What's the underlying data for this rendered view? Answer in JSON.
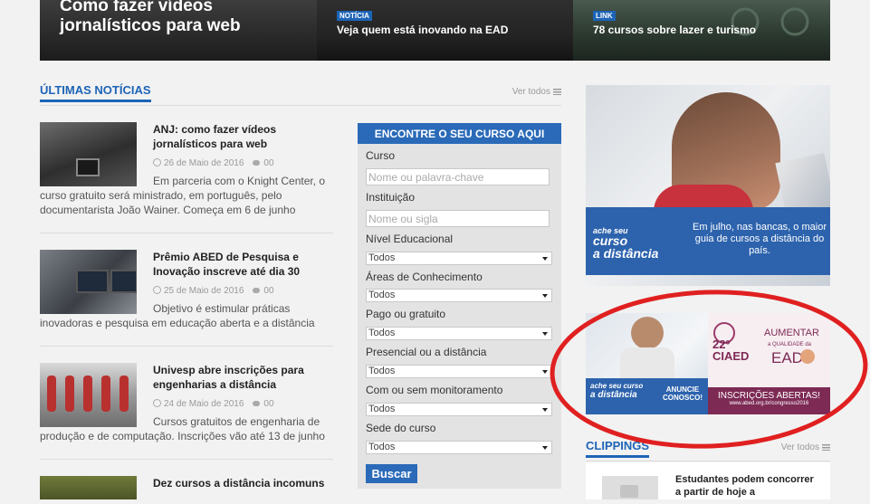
{
  "top_features": [
    {
      "title": "Como fazer vídeos jornalísticos para web"
    },
    {
      "tag": "NOTÍCIA",
      "title": "Veja quem está inovando na EAD"
    },
    {
      "tag": "LINK",
      "title": "78 cursos sobre lazer e turismo"
    }
  ],
  "latest_news": {
    "heading": "ÚLTIMAS NOTÍCIAS",
    "see_all": "Ver todos",
    "items": [
      {
        "title": "ANJ: como fazer vídeos jornalísticos para web",
        "date": "26 de Maio de 2016",
        "comments": "00",
        "excerpt": "Em parceria com o Knight Center, o curso gratuito será ministrado, em português, pelo documentarista João Wainer. Começa em 6 de junho"
      },
      {
        "title": "Prêmio ABED de Pesquisa e Inovação inscreve até dia 30",
        "date": "25 de Maio de 2016",
        "comments": "00",
        "excerpt": "Objetivo é estimular práticas inovadoras e pesquisa em educação aberta e a distância"
      },
      {
        "title": "Univesp abre inscrições para engenharias a distância",
        "date": "24 de Maio de 2016",
        "comments": "00",
        "excerpt": "Cursos gratuitos de engenharia de produção e de computação. Inscrições vão até 13 de junho"
      },
      {
        "title": "Dez cursos a distância incomuns"
      }
    ]
  },
  "course_search": {
    "heading": "ENCONTRE O SEU CURSO AQUI",
    "fields": {
      "curso_label": "Curso",
      "curso_placeholder": "Nome ou palavra-chave",
      "instituicao_label": "Instituição",
      "instituicao_placeholder": "Nome ou sigla",
      "nivel_label": "Nível Educacional",
      "nivel_value": "Todos",
      "areas_label": "Áreas de Conhecimento",
      "areas_value": "Todos",
      "pago_label": "Pago ou gratuito",
      "pago_value": "Todos",
      "presencial_label": "Presencial ou a distância",
      "presencial_value": "Todos",
      "monitoramento_label": "Com ou sem monitoramento",
      "monitoramento_value": "Todos",
      "sede_label": "Sede do curso",
      "sede_value": "Todos"
    },
    "button": "Buscar"
  },
  "ads": {
    "ad1": {
      "logo_line1": "ache seu",
      "logo_line2": "curso",
      "logo_line3": "a distância",
      "text": "Em julho, nas bancas, o maior guia de cursos a distância do país."
    },
    "ad2": {
      "logo_line1": "ache seu curso",
      "logo_line2": "a distância",
      "cta": "ANUNCIE CONOSCO!",
      "event_number": "22º",
      "event_name": "CIAED",
      "slogan_1": "AUMENTAR",
      "slogan_2": "a QUALIDADE da",
      "slogan_3": "EAD",
      "footer": "INSCRIÇÕES ABERTAS!",
      "url": "www.abed.org.br/congresso2016"
    }
  },
  "clippings": {
    "heading": "CLIPPINGS",
    "see_all": "Ver todos",
    "first_title": "Estudantes podem concorrer a partir de hoje a"
  },
  "colors": {
    "accent": "#1d64b7",
    "annotation": "#e02020"
  }
}
